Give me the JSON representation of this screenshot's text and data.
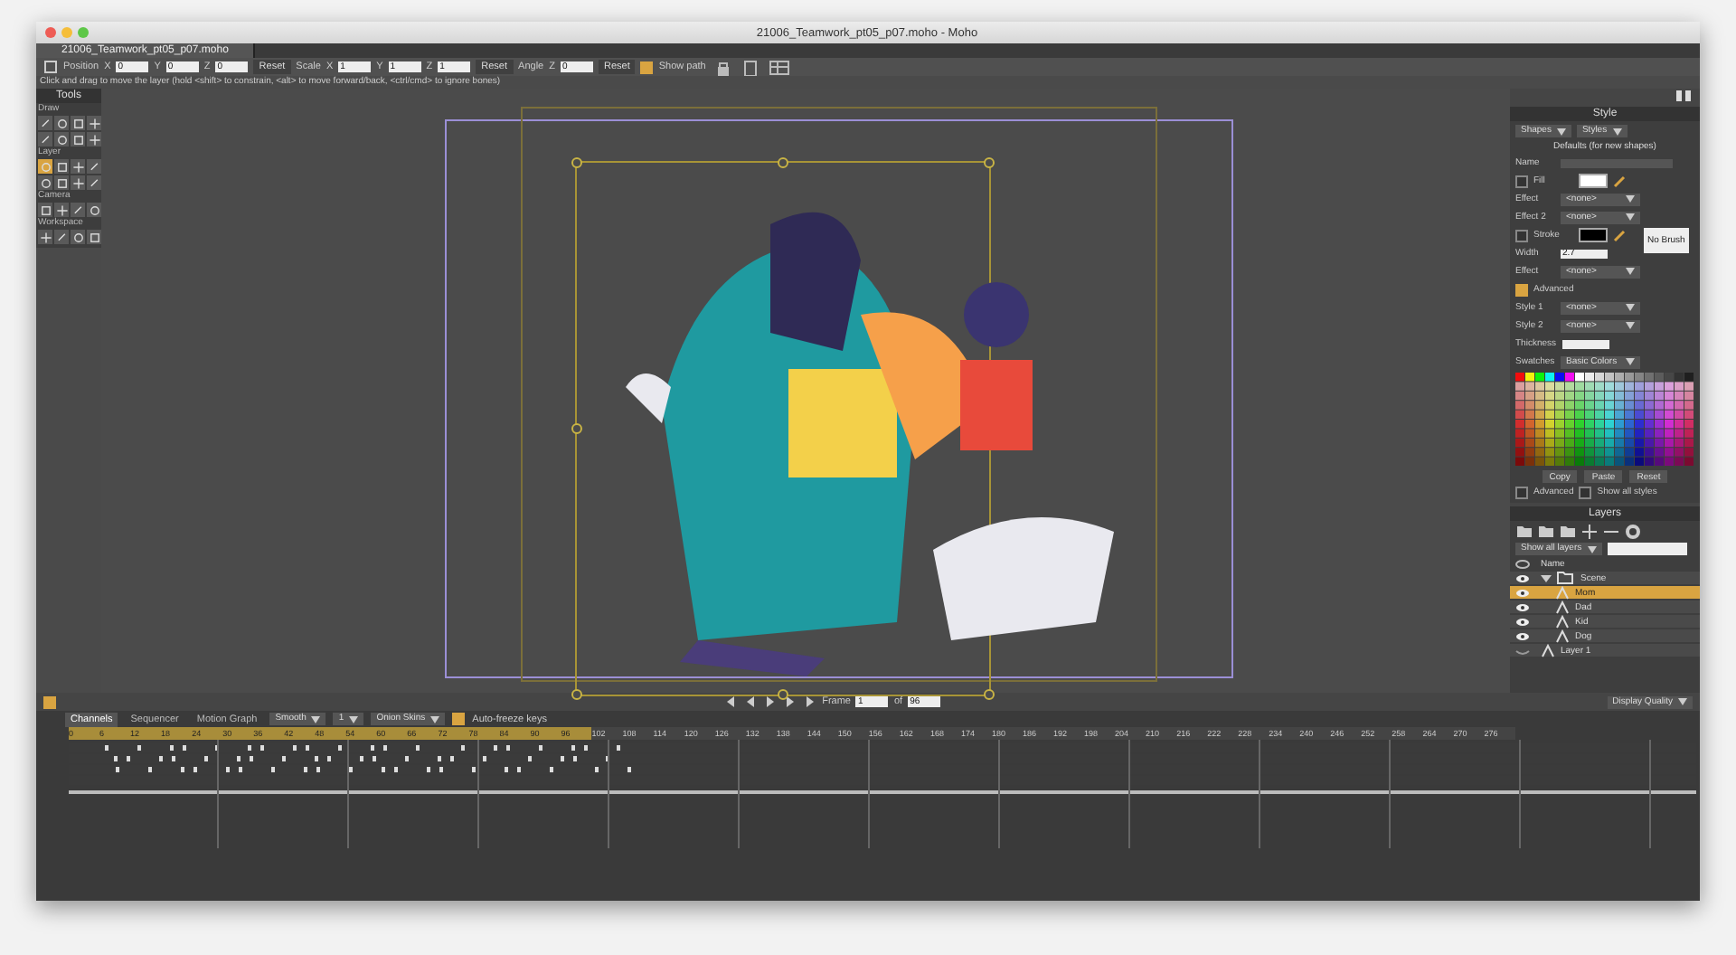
{
  "window": {
    "title": "21006_Teamwork_pt05_p07.moho - Moho"
  },
  "document_tab": {
    "label": "21006_Teamwork_pt05_p07.moho",
    "selected": true
  },
  "toolbar": {
    "label": "Position",
    "items": [
      {
        "kind": "field",
        "label": "X",
        "value": "0"
      },
      {
        "kind": "field",
        "label": "Y",
        "value": "0"
      },
      {
        "kind": "field",
        "label": "Z",
        "value": "0"
      },
      {
        "kind": "button",
        "label": "Reset"
      },
      {
        "kind": "text",
        "label": "Scale"
      },
      {
        "kind": "field",
        "label": "X",
        "value": "1"
      },
      {
        "kind": "field",
        "label": "Y",
        "value": "1"
      },
      {
        "kind": "field",
        "label": "Z",
        "value": "1"
      },
      {
        "kind": "button",
        "label": "Reset"
      },
      {
        "kind": "text",
        "label": "Angle"
      },
      {
        "kind": "field",
        "label": "Z",
        "value": "0"
      },
      {
        "kind": "button",
        "label": "Reset"
      },
      {
        "kind": "check",
        "label": "Show path",
        "checked": true
      }
    ]
  },
  "hint": "Click and drag to move the layer (hold <shift> to constrain, <alt> to move forward/back, <ctrl/cmd> to ignore bones)",
  "tools": {
    "title": "Tools",
    "sections": [
      {
        "label": "Draw",
        "tools": [
          {
            "selected": false
          },
          {
            "selected": false
          },
          {
            "selected": false
          },
          {
            "selected": false
          },
          {
            "selected": false
          },
          {
            "selected": false
          },
          {
            "selected": false
          },
          {
            "selected": false
          }
        ]
      },
      {
        "label": "Layer",
        "tools": [
          {
            "selected": true
          },
          {
            "selected": false
          },
          {
            "selected": false
          },
          {
            "selected": false
          },
          {
            "selected": false
          },
          {
            "selected": false
          },
          {
            "selected": false
          },
          {
            "selected": false
          }
        ]
      },
      {
        "label": "Camera",
        "tools": [
          {
            "selected": false
          },
          {
            "selected": false
          },
          {
            "selected": false
          },
          {
            "selected": false
          }
        ]
      },
      {
        "label": "Workspace",
        "tools": [
          {
            "selected": false
          },
          {
            "selected": false
          },
          {
            "selected": false
          },
          {
            "selected": false
          }
        ]
      }
    ]
  },
  "playback": {
    "loop": {
      "checked": true
    },
    "frame_label": "Frame",
    "frame": "1",
    "of_label": "of",
    "total": "96",
    "quality": "Display Quality"
  },
  "style": {
    "title": "Style",
    "dropdowns": [
      "Shapes",
      "Styles"
    ],
    "caption": "Defaults (for new shapes)",
    "name_label": "Name",
    "rows": [
      {
        "kind": "color",
        "label": "Fill",
        "checked": false,
        "color": "#ffffff"
      },
      {
        "kind": "select",
        "label": "Effect",
        "value": "<none>"
      },
      {
        "kind": "select",
        "label": "Effect 2",
        "value": "<none>"
      },
      {
        "kind": "color",
        "label": "Stroke",
        "checked": false,
        "color": "#000000"
      },
      {
        "kind": "value",
        "label": "Width",
        "value": "2.7"
      },
      {
        "kind": "select",
        "label": "Effect",
        "value": "<none>"
      }
    ],
    "brush_button": "No Brush",
    "advanced": {
      "label": "Advanced",
      "checked": true
    },
    "selects": [
      {
        "label": "Style 1",
        "value": "<none>"
      },
      {
        "label": "Style 2",
        "value": "<none>"
      }
    ],
    "thickness_label": "Thickness",
    "swatches": {
      "label": "Swatches",
      "value": "Basic Colors"
    },
    "buttons": [
      "Copy",
      "Paste",
      "Reset"
    ],
    "checks": [
      {
        "label": "Advanced",
        "checked": false
      },
      {
        "label": "Show all styles",
        "checked": false
      }
    ]
  },
  "layers": {
    "title": "Layers",
    "filter": "Show all layers",
    "column": "Name",
    "items": [
      {
        "name": "Scene",
        "kind": "group",
        "selected": false,
        "visible": true,
        "expanded": true,
        "children": [
          {
            "name": "Mom",
            "kind": "vector",
            "selected": true,
            "visible": true
          },
          {
            "name": "Dad",
            "kind": "vector",
            "selected": false,
            "visible": true
          },
          {
            "name": "Kid",
            "kind": "vector",
            "selected": false,
            "visible": true
          },
          {
            "name": "Dog",
            "kind": "vector",
            "selected": false,
            "visible": true
          }
        ]
      },
      {
        "name": "Layer 1",
        "kind": "vector",
        "selected": false,
        "visible": false
      }
    ]
  },
  "timeline": {
    "tabs": [
      {
        "label": "Channels",
        "selected": true
      },
      {
        "label": "Sequencer",
        "selected": false
      },
      {
        "label": "Motion Graph",
        "selected": false
      }
    ],
    "controls": [
      {
        "kind": "dropdown",
        "label": "Smooth"
      },
      {
        "kind": "dropdown",
        "label": "1"
      },
      {
        "kind": "dropdown",
        "label": "Onion Skins"
      },
      {
        "kind": "check",
        "label": "Auto-freeze keys",
        "checked": true
      }
    ],
    "ruler": [
      {
        "label": "0",
        "in_range": true
      },
      {
        "label": "6",
        "in_range": true
      },
      {
        "label": "12",
        "in_range": true
      },
      {
        "label": "18",
        "in_range": true
      },
      {
        "label": "24",
        "in_range": true
      },
      {
        "label": "30",
        "in_range": true
      },
      {
        "label": "36",
        "in_range": true
      },
      {
        "label": "42",
        "in_range": true
      },
      {
        "label": "48",
        "in_range": true
      },
      {
        "label": "54",
        "in_range": true
      },
      {
        "label": "60",
        "in_range": true
      },
      {
        "label": "66",
        "in_range": true
      },
      {
        "label": "72",
        "in_range": true
      },
      {
        "label": "78",
        "in_range": true
      },
      {
        "label": "84",
        "in_range": true
      },
      {
        "label": "90",
        "in_range": true
      },
      {
        "label": "96",
        "in_range": true
      },
      {
        "label": "102",
        "in_range": false
      },
      {
        "label": "108",
        "in_range": false
      },
      {
        "label": "114",
        "in_range": false
      },
      {
        "label": "120",
        "in_range": false
      },
      {
        "label": "126",
        "in_range": false
      },
      {
        "label": "132",
        "in_range": false
      },
      {
        "label": "138",
        "in_range": false
      },
      {
        "label": "144",
        "in_range": false
      },
      {
        "label": "150",
        "in_range": false
      },
      {
        "label": "156",
        "in_range": false
      },
      {
        "label": "162",
        "in_range": false
      },
      {
        "label": "168",
        "in_range": false
      },
      {
        "label": "174",
        "in_range": false
      },
      {
        "label": "180",
        "in_range": false
      },
      {
        "label": "186",
        "in_range": false
      },
      {
        "label": "192",
        "in_range": false
      },
      {
        "label": "198",
        "in_range": false
      },
      {
        "label": "204",
        "in_range": false
      },
      {
        "label": "210",
        "in_range": false
      },
      {
        "label": "216",
        "in_range": false
      },
      {
        "label": "222",
        "in_range": false
      },
      {
        "label": "228",
        "in_range": false
      },
      {
        "label": "234",
        "in_range": false
      },
      {
        "label": "240",
        "in_range": false
      },
      {
        "label": "246",
        "in_range": false
      },
      {
        "label": "252",
        "in_range": false
      },
      {
        "label": "258",
        "in_range": false
      },
      {
        "label": "264",
        "in_range": false
      },
      {
        "label": "270",
        "in_range": false
      },
      {
        "label": "276",
        "in_range": false
      }
    ]
  }
}
